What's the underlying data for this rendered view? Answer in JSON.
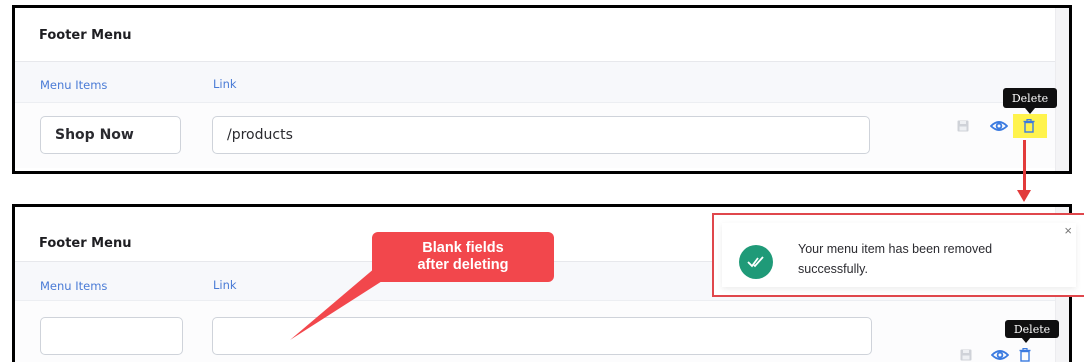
{
  "top_panel": {
    "title": "Footer Menu",
    "columns": {
      "menu_items": "Menu Items",
      "link": "Link"
    },
    "row": {
      "menu_item_value": "Shop Now",
      "link_value": "/products"
    },
    "tooltip": "Delete"
  },
  "bottom_panel": {
    "title": "Footer Menu",
    "columns": {
      "menu_items": "Menu Items",
      "link": "Link"
    },
    "row": {
      "menu_item_value": "",
      "link_value": ""
    },
    "tooltip": "Delete"
  },
  "toast": {
    "message": "Your menu item has been removed successfully.",
    "close": "×"
  },
  "callout": {
    "line1": "Blank fields",
    "line2": "after deleting"
  },
  "icons": [
    "save-icon",
    "eye-icon",
    "trash-icon",
    "check-icon",
    "close-icon"
  ],
  "colors": {
    "accent_blue": "#4a7bd6",
    "annotation_red": "#e23b3b",
    "highlight_yellow": "#fff34d",
    "success_green": "#1f9a78"
  }
}
